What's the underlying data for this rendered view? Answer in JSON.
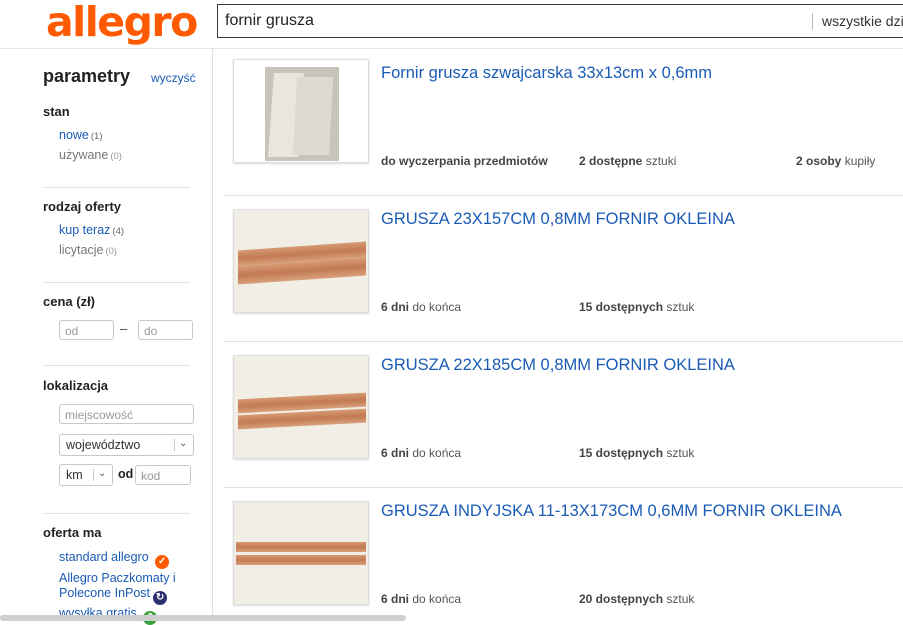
{
  "header": {
    "logo": "allegro",
    "search_value": "fornir grusza",
    "category": "wszystkie dzia"
  },
  "sidebar": {
    "title": "parametry",
    "clear": "wyczyść",
    "stan": {
      "heading": "stan",
      "options": [
        {
          "label": "nowe",
          "count": "(1)"
        },
        {
          "label": "używane",
          "count": "(0)"
        }
      ]
    },
    "rodzaj": {
      "heading": "rodzaj oferty",
      "options": [
        {
          "label": "kup teraz",
          "count": "(4)"
        },
        {
          "label": "licytacje",
          "count": "(0)"
        }
      ]
    },
    "cena": {
      "heading": "cena (zł)",
      "from_placeholder": "od",
      "to_placeholder": "do",
      "dash": "–"
    },
    "lokalizacja": {
      "heading": "lokalizacja",
      "city_placeholder": "miejscowość",
      "region_value": "województwo",
      "km_value": "km",
      "od_label": "od",
      "code_placeholder": "kod"
    },
    "oferta": {
      "heading": "oferta ma",
      "items": [
        {
          "label": "standard allegro"
        },
        {
          "label_line1": "Allegro Paczkomaty i",
          "label_line2": "Polecone InPost"
        },
        {
          "label": "wysyłka gratis"
        }
      ]
    }
  },
  "listings": [
    {
      "title": "Fornir grusza szwajcarska 33x13cm x 0,6mm",
      "meta1_bold": "do wyczerpania przedmiotów",
      "meta1_rest": "",
      "meta2_bold": "2 dostępne",
      "meta2_rest": " sztuki",
      "meta3_bold": "2 osoby",
      "meta3_rest": " kupiły"
    },
    {
      "title": "GRUSZA 23X157CM 0,8MM FORNIR OKLEINA",
      "meta1_bold": "6 dni",
      "meta1_rest": " do końca",
      "meta2_bold": "15 dostępnych",
      "meta2_rest": " sztuk"
    },
    {
      "title": "GRUSZA 22X185CM 0,8MM FORNIR OKLEINA",
      "meta1_bold": "6 dni",
      "meta1_rest": " do końca",
      "meta2_bold": "15 dostępnych",
      "meta2_rest": " sztuk"
    },
    {
      "title": "GRUSZA INDYJSKA 11-13X173CM 0,6MM FORNIR OKLEINA",
      "meta1_bold": "6 dni",
      "meta1_rest": " do końca",
      "meta2_bold": "20 dostępnych",
      "meta2_rest": " sztuk"
    }
  ],
  "colors": {
    "brand": "#ff5a00",
    "link": "#1a5bb5",
    "standard_badge": "#ff5a00",
    "inpost_badge": "#2b2f6b",
    "free_shipping_badge": "#3aa13a"
  }
}
